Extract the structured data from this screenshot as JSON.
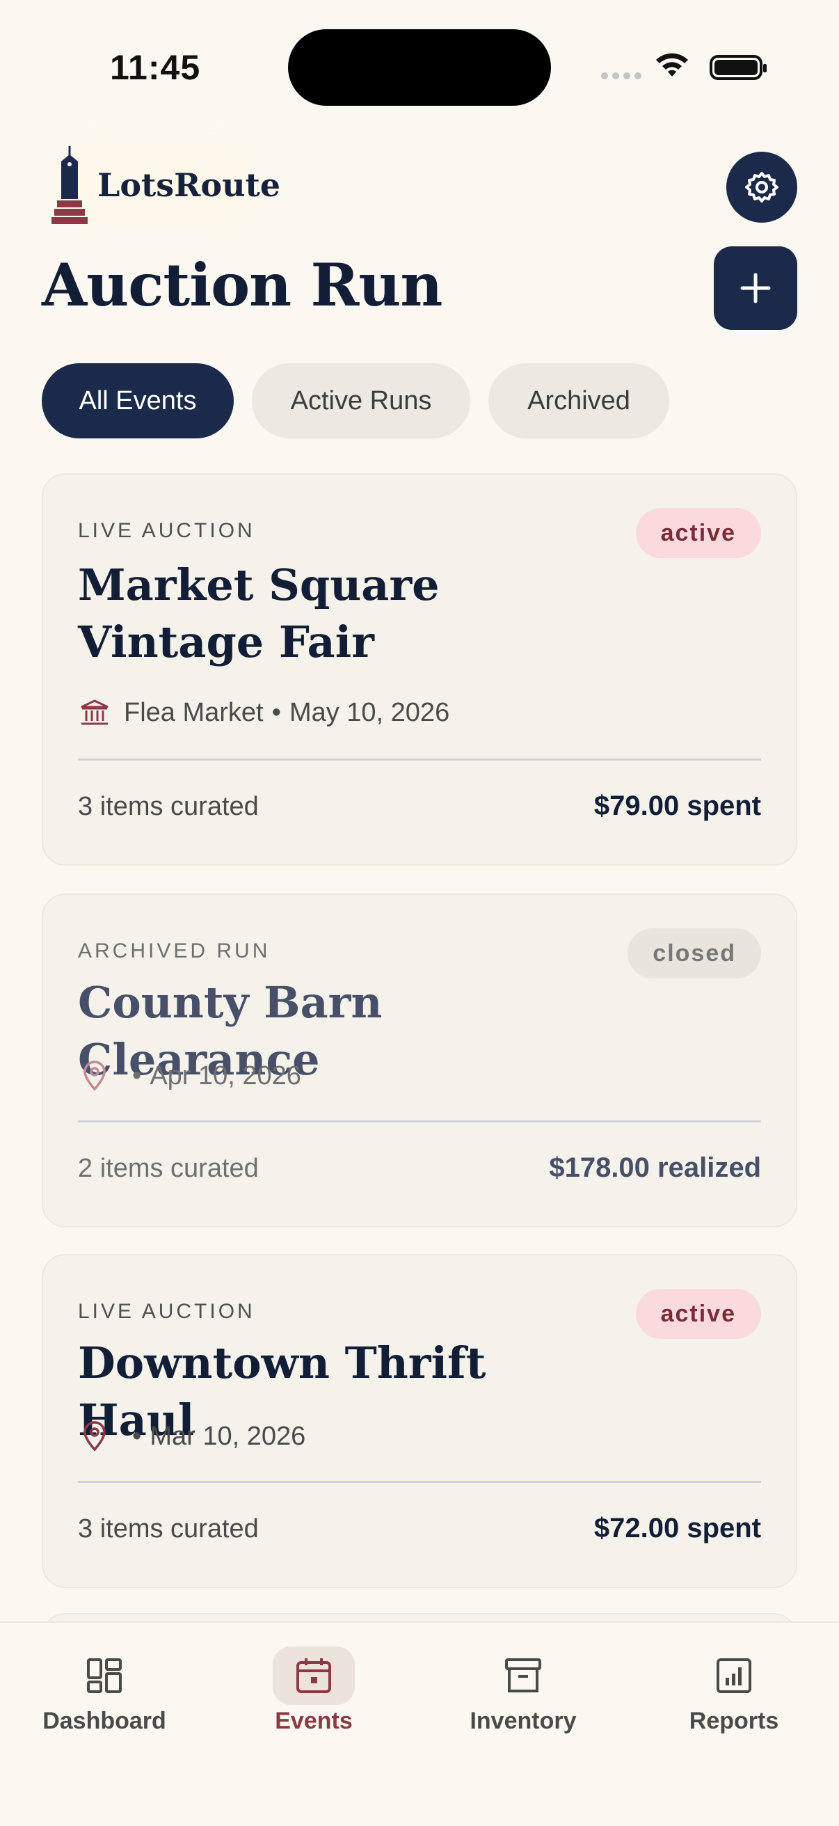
{
  "status_bar": {
    "time": "11:45"
  },
  "header": {
    "brand_name": "LotsRoute",
    "page_title": "Auction Run"
  },
  "tabs": [
    {
      "label": "All Events",
      "active": true
    },
    {
      "label": "Active Runs",
      "active": false
    },
    {
      "label": "Archived",
      "active": false
    }
  ],
  "cards": [
    {
      "kicker": "LIVE AUCTION",
      "badge": "active",
      "title": "Market Square Vintage Fair",
      "venue": "Flea Market",
      "separator": "•",
      "date": "May 10, 2026",
      "venue_icon": "building-columns-icon",
      "items": "3 items curated",
      "amount": "$79.00 spent"
    },
    {
      "kicker": "ARCHIVED RUN",
      "badge": "closed",
      "title": "County Barn Clearance",
      "venue": "",
      "separator": "•",
      "date": "Apr 10, 2026",
      "venue_icon": "map-pin-icon",
      "items": "2 items curated",
      "amount": "$178.00 realized"
    },
    {
      "kicker": "LIVE AUCTION",
      "badge": "active",
      "title": "Downtown Thrift Haul",
      "venue": "",
      "separator": "•",
      "date": "Mar 10, 2026",
      "venue_icon": "map-pin-icon",
      "items": "3 items curated",
      "amount": "$72.00 spent"
    }
  ],
  "bottom_nav": [
    {
      "label": "Dashboard",
      "icon": "dashboard-grid-icon",
      "active": false
    },
    {
      "label": "Events",
      "icon": "calendar-icon",
      "active": true
    },
    {
      "label": "Inventory",
      "icon": "archive-box-icon",
      "active": false
    },
    {
      "label": "Reports",
      "icon": "bar-chart-icon",
      "active": false
    }
  ],
  "colors": {
    "primary": "#1b2a4a",
    "accent": "#8b3a45",
    "active_badge_bg": "#fadadd",
    "background": "#fbf8f2"
  }
}
